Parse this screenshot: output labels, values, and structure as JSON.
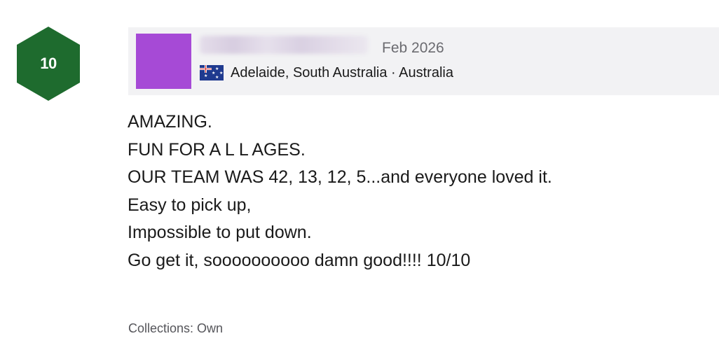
{
  "rating": {
    "value": "10",
    "badge_color": "#1e6b2e"
  },
  "author": {
    "avatar_color": "#a64ad6",
    "username_blurred": true,
    "date": "Feb 2026",
    "flag_icon": "australia-flag-icon",
    "location": "Adelaide, South Australia · Australia"
  },
  "review": {
    "lines": [
      "AMAZING.",
      "FUN FOR A L L AGES.",
      "OUR TEAM WAS 42, 13, 12, 5...and everyone loved it.",
      "Easy to pick up,",
      "Impossible to put down.",
      "Go get it, soooooooooo damn good!!!! 10/10"
    ]
  },
  "collections": {
    "text": "Collections: Own"
  }
}
